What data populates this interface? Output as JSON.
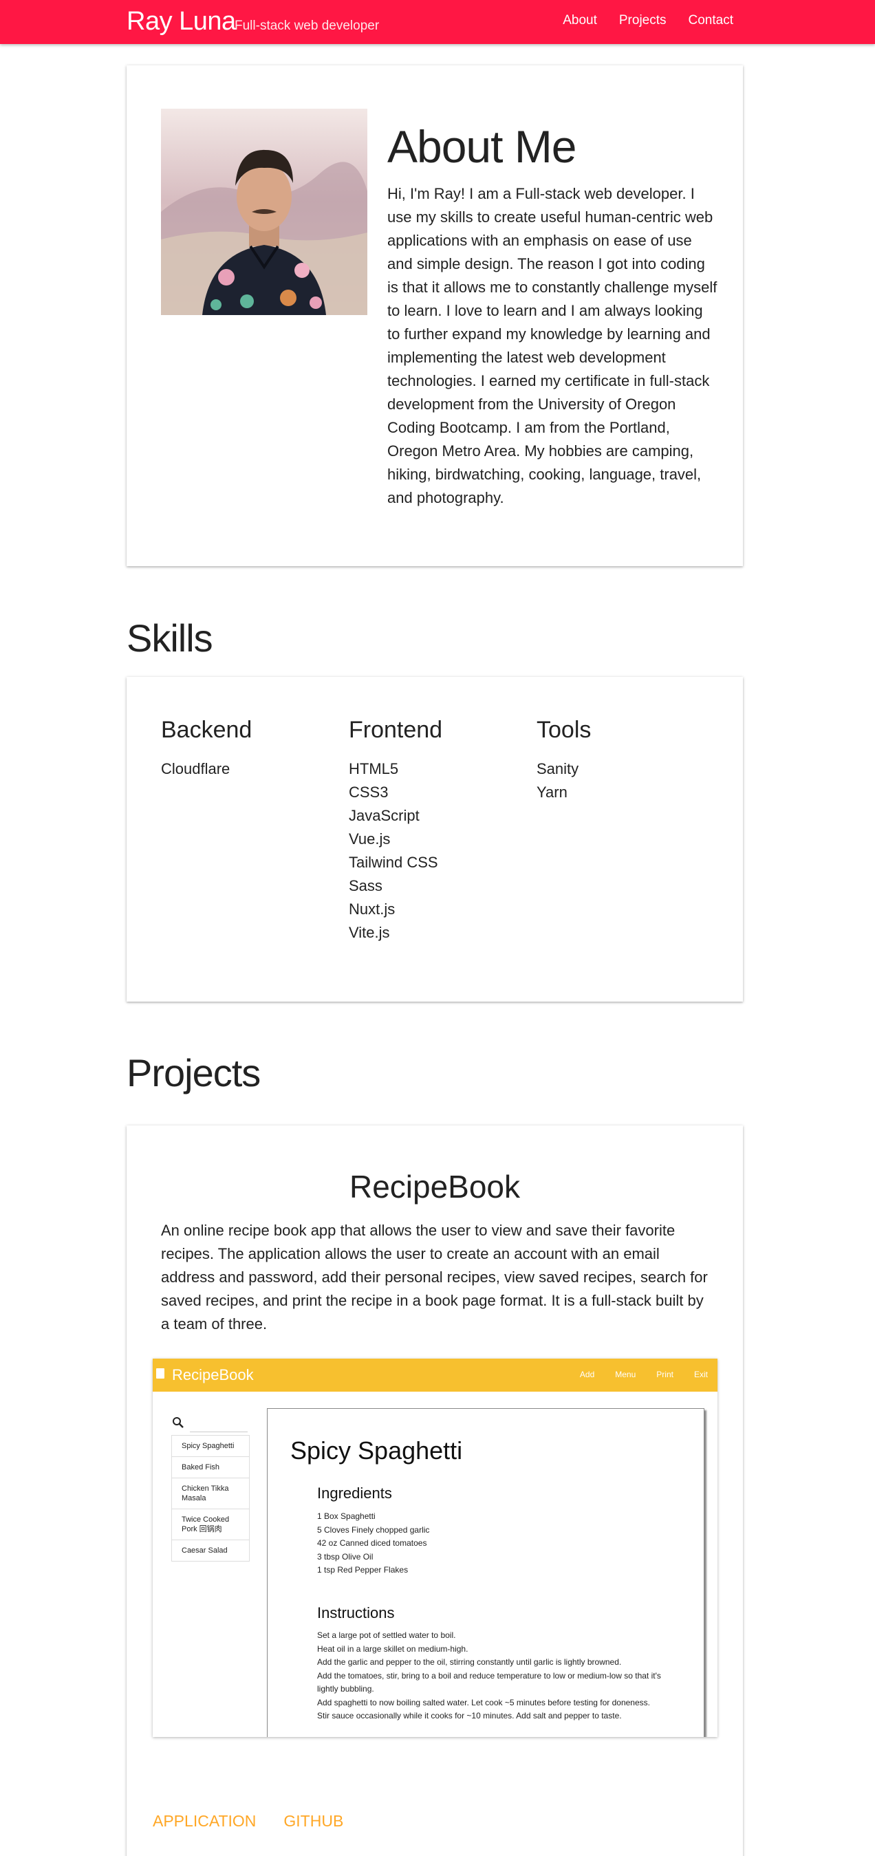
{
  "header": {
    "name": "Ray Luna",
    "tagline": "Full-stack web developer",
    "nav": [
      "About",
      "Projects",
      "Contact"
    ],
    "color": "#ff1744"
  },
  "about": {
    "title": "About Me",
    "text": "Hi, I'm Ray! I am a Full-stack web developer. I use my skills to create useful human-centric web applications with an emphasis on ease of use and simple design. The reason I got into coding is that it allows me to constantly challenge myself to learn. I love to learn and I am always looking to further expand my knowledge by learning and implementing the latest web development technologies. I earned my certificate in full-stack development from the University of Oregon Coding Bootcamp. I am from the Portland, Oregon Metro Area. My hobbies are camping, hiking, birdwatching, cooking, language, travel, and photography."
  },
  "skills": {
    "title": "Skills",
    "columns": [
      {
        "heading": "Backend",
        "items": [
          "Cloudflare"
        ]
      },
      {
        "heading": "Frontend",
        "items": [
          "HTML5",
          "CSS3",
          "JavaScript",
          "Vue.js",
          "Tailwind CSS",
          "Sass",
          "Nuxt.js",
          "Vite.js"
        ]
      },
      {
        "heading": "Tools",
        "items": [
          "Sanity",
          "Yarn"
        ]
      }
    ]
  },
  "projects": {
    "title": "Projects",
    "items": [
      {
        "name": "RecipeBook",
        "description": "An online recipe book app that allows the user to view and save their favorite recipes. The application allows the user to create an account with an email address and password, add their personal recipes, view saved recipes, search for saved recipes, and print the recipe in a book page format. It is a full-stack built by a team of three.",
        "links": [
          "APPLICATION",
          "GITHUB"
        ],
        "screenshot": {
          "app_title": "RecipeBook",
          "nav": [
            "Add",
            "Menu",
            "Print",
            "Exit"
          ],
          "recipes": [
            "Spicy Spaghetti",
            "Baked Fish",
            "Chicken Tikka Masala",
            "Twice Cooked Pork 回锅肉",
            "Caesar Salad"
          ],
          "recipe_title": "Spicy Spaghetti",
          "ingredients_heading": "Ingredients",
          "ingredients": [
            "1 Box Spaghetti",
            "5 Cloves Finely chopped garlic",
            "42 oz Canned diced tomatoes",
            "3 tbsp Olive Oil",
            "1 tsp Red Pepper Flakes"
          ],
          "instructions_heading": "Instructions",
          "instructions": [
            "Set a large pot of settled water to boil.",
            "Heat oil in a large skillet on medium-high.",
            "Add the garlic and pepper to the oil, stirring constantly until garlic is lightly browned.",
            "Add the tomatoes, stir, bring to a boil and reduce temperature to low or medium-low so that it's lightly bubbling.",
            "Add spaghetti to now boiling salted water. Let cook ~5 minutes before testing for doneness.",
            "Stir sauce occasionally while it cooks for ~10 minutes. Add salt and pepper to taste."
          ],
          "accent": "#f7c02f"
        }
      }
    ]
  },
  "link_color": "#ffa726"
}
